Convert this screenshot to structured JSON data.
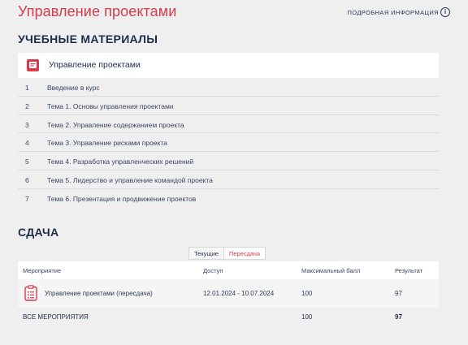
{
  "header": {
    "title": "Управление проектами",
    "info_link": "ПОДРОБНАЯ ИНФОРМАЦИЯ",
    "info_icon": "info-icon"
  },
  "materials": {
    "section_title": "УЧЕБНЫЕ МАТЕРИАЛЫ",
    "course": {
      "icon": "book-icon",
      "title": "Управление проектами"
    },
    "topics": [
      {
        "num": "1",
        "title": "Введение в курс"
      },
      {
        "num": "2",
        "title": "Тема 1. Основы управления проектами"
      },
      {
        "num": "3",
        "title": "Тема 2. Управление содержанием проекта"
      },
      {
        "num": "4",
        "title": "Тема 3. Управление рисками проекта"
      },
      {
        "num": "5",
        "title": "Тема 4. Разработка управленческих решений"
      },
      {
        "num": "6",
        "title": "Тема 5. Лидерство и управление командой проекта"
      },
      {
        "num": "7",
        "title": "Тема 6. Презентация и продвижение проектов"
      }
    ]
  },
  "submission": {
    "section_title": "СДАЧА",
    "tabs": {
      "current": "Текущие",
      "retake": "Пересдача"
    },
    "table": {
      "columns": [
        "Мероприятие",
        "Доступ",
        "Максимальный балл",
        "Результат"
      ],
      "rows": [
        {
          "icon": "clipboard-icon",
          "event": "Управление проектами (пересдача)",
          "access": "12.01.2024 - 10.07.2024",
          "max": "100",
          "result": "97"
        }
      ],
      "total": {
        "label": "ВСЕ МЕРОПРИЯТИЯ",
        "max": "100",
        "result": "97"
      }
    }
  },
  "colors": {
    "accent": "#d63a4d",
    "text": "#1f2d4a",
    "background": "#efefef"
  }
}
